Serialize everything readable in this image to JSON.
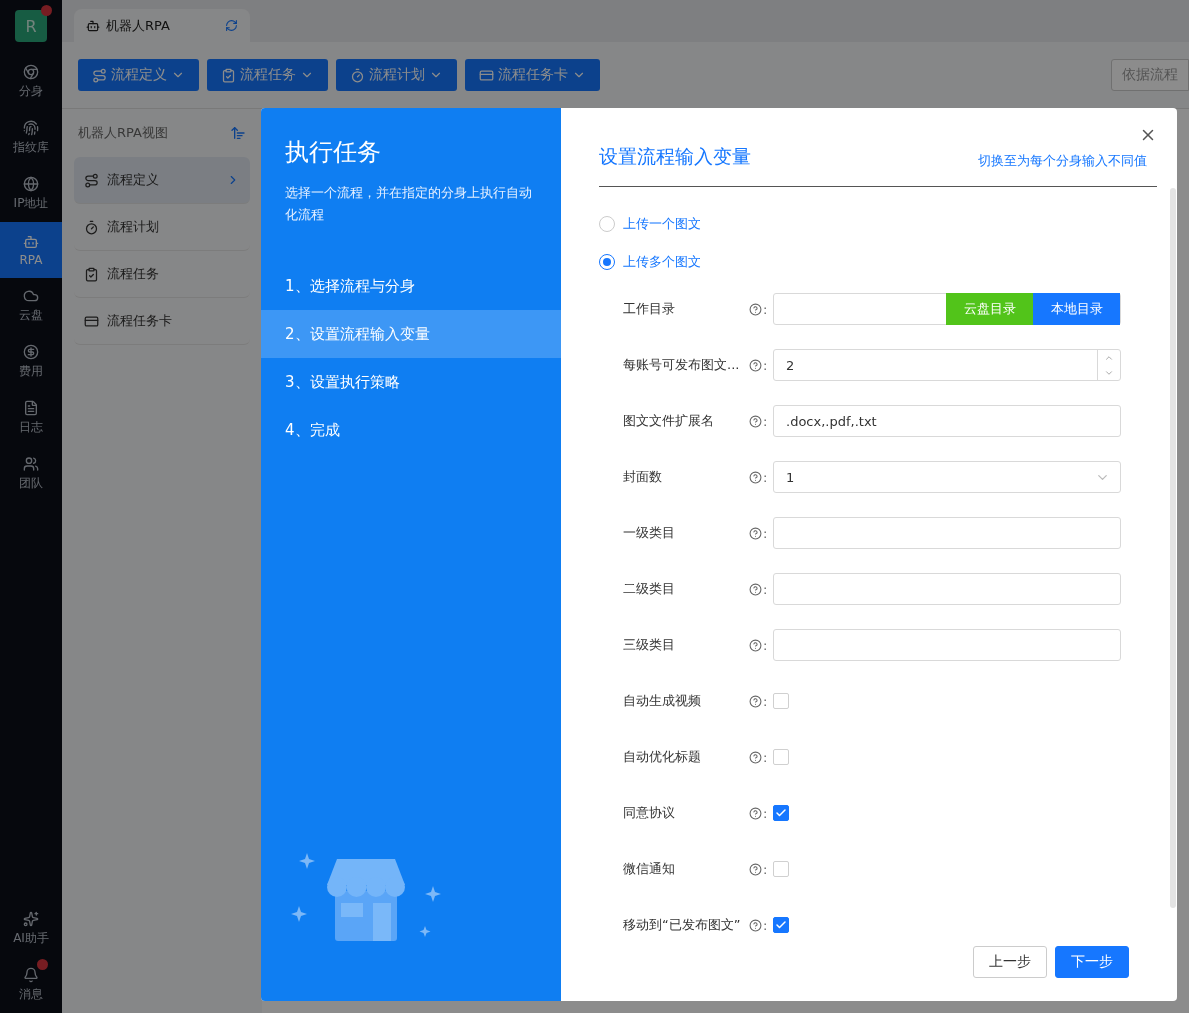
{
  "rail": {
    "avatar": "R",
    "avatar_badge": true,
    "items": [
      {
        "label": "分身",
        "selected": false
      },
      {
        "label": "指纹库",
        "selected": false
      },
      {
        "label": "IP地址",
        "selected": false
      },
      {
        "label": "RPA",
        "selected": true
      },
      {
        "label": "云盘",
        "selected": false
      },
      {
        "label": "费用",
        "selected": false
      },
      {
        "label": "日志",
        "selected": false
      },
      {
        "label": "团队",
        "selected": false
      }
    ],
    "bottom_items": [
      {
        "label": "AI助手",
        "badge": false
      },
      {
        "label": "消息",
        "badge": true
      }
    ]
  },
  "tab": {
    "label": "机器人RPA"
  },
  "toolbar": {
    "buttons": [
      {
        "label": "流程定义"
      },
      {
        "label": "流程任务"
      },
      {
        "label": "流程计划"
      },
      {
        "label": "流程任务卡"
      }
    ],
    "search_button": "依据流程"
  },
  "sidebar": {
    "title": "机器人RPA视图",
    "items": [
      {
        "label": "流程定义",
        "selected": true
      },
      {
        "label": "流程计划",
        "selected": false
      },
      {
        "label": "流程任务",
        "selected": false
      },
      {
        "label": "流程任务卡",
        "selected": false
      }
    ]
  },
  "dialog": {
    "title": "执行任务",
    "subtitle": "选择一个流程，并在指定的分身上执行自动化流程",
    "steps": [
      {
        "label": "1、选择流程与分身",
        "selected": false
      },
      {
        "label": "2、设置流程输入变量",
        "selected": true
      },
      {
        "label": "3、设置执行策略",
        "selected": false
      },
      {
        "label": "4、完成",
        "selected": false
      }
    ],
    "section_title": "设置流程输入变量",
    "switch_link": "切换至为每个分身输入不同值",
    "upload_options": [
      {
        "label": "上传一个图文",
        "selected": false
      },
      {
        "label": "上传多个图文",
        "selected": true
      }
    ],
    "fields": [
      {
        "kind": "directory",
        "label": "工作目录",
        "colon": ":",
        "buttons": [
          "云盘目录",
          "本地目录"
        ]
      },
      {
        "kind": "number",
        "label": "每账号可发布图文...",
        "colon": ":",
        "value": "2"
      },
      {
        "kind": "text",
        "label": "图文文件扩展名",
        "colon": ":",
        "value": ".docx,.pdf,.txt"
      },
      {
        "kind": "select",
        "label": "封面数",
        "colon": ":",
        "value": "1"
      },
      {
        "kind": "text",
        "label": "一级类目",
        "colon": ":"
      },
      {
        "kind": "text",
        "label": "二级类目",
        "colon": ":"
      },
      {
        "kind": "text",
        "label": "三级类目",
        "colon": ":"
      },
      {
        "kind": "checkbox",
        "label": "自动生成视频",
        "colon": ":",
        "checked": false
      },
      {
        "kind": "checkbox",
        "label": "自动优化标题",
        "colon": ":",
        "checked": false
      },
      {
        "kind": "checkbox",
        "label": "同意协议",
        "colon": ":",
        "checked": true
      },
      {
        "kind": "checkbox",
        "label": "微信通知",
        "colon": ":",
        "checked": false
      },
      {
        "kind": "checkbox",
        "label": "移动到“已发布图文”",
        "colon": ":",
        "checked": true
      }
    ],
    "prev_button": "上一步",
    "next_button": "下一步"
  }
}
